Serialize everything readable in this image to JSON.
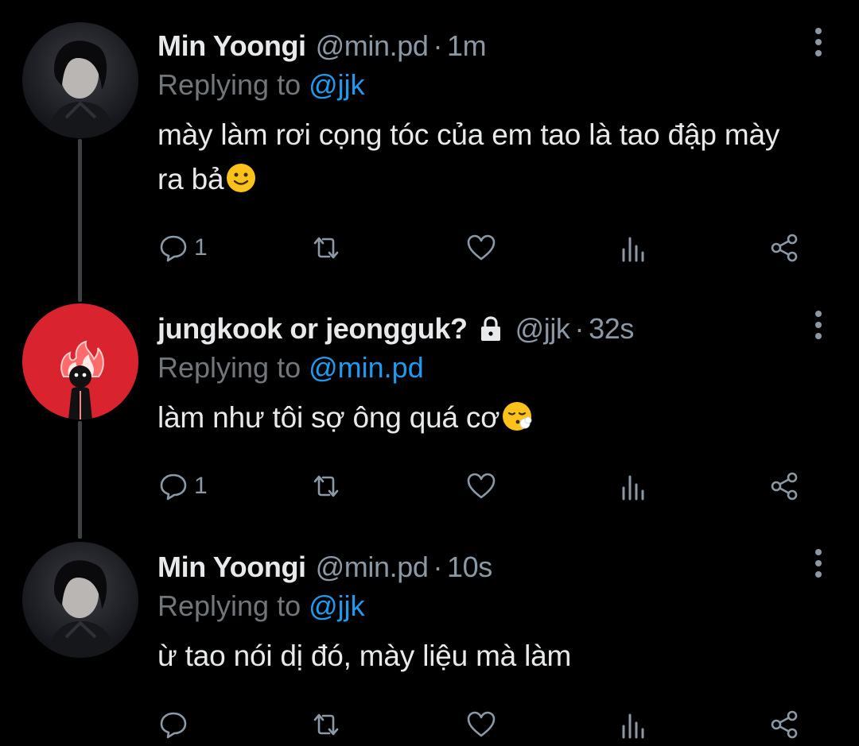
{
  "tweets": [
    {
      "display_name": "Min Yoongi",
      "handle": "@min.pd",
      "separator": "·",
      "time": "1m",
      "replying_label": "Replying to",
      "reply_target": "@jjk",
      "text": "mày làm rơi cọng tóc của em tao là tao đập mày ra bả",
      "emoji": "slightly-smiling-face-icon",
      "reply_count": "1",
      "locked": false
    },
    {
      "display_name": "jungkook or jeongguk?",
      "handle": "@jjk",
      "separator": "·",
      "time": "32s",
      "replying_label": "Replying to",
      "reply_target": "@min.pd",
      "text": "làm như tôi sợ ông quá cơ",
      "emoji": "face-exhaling-icon",
      "reply_count": "1",
      "locked": true
    },
    {
      "display_name": "Min Yoongi",
      "handle": "@min.pd",
      "separator": "·",
      "time": "10s",
      "replying_label": "Replying to",
      "reply_target": "@jjk",
      "text": "ừ tao nói dị đó, mày liệu mà làm",
      "emoji": "",
      "reply_count": "",
      "locked": false
    }
  ],
  "colors": {
    "background": "#000000",
    "text": "#e7e9ea",
    "muted": "#8b98a5",
    "link": "#1d9bf0",
    "thread_line": "#3e4144",
    "avatar_red": "#d9232f"
  }
}
